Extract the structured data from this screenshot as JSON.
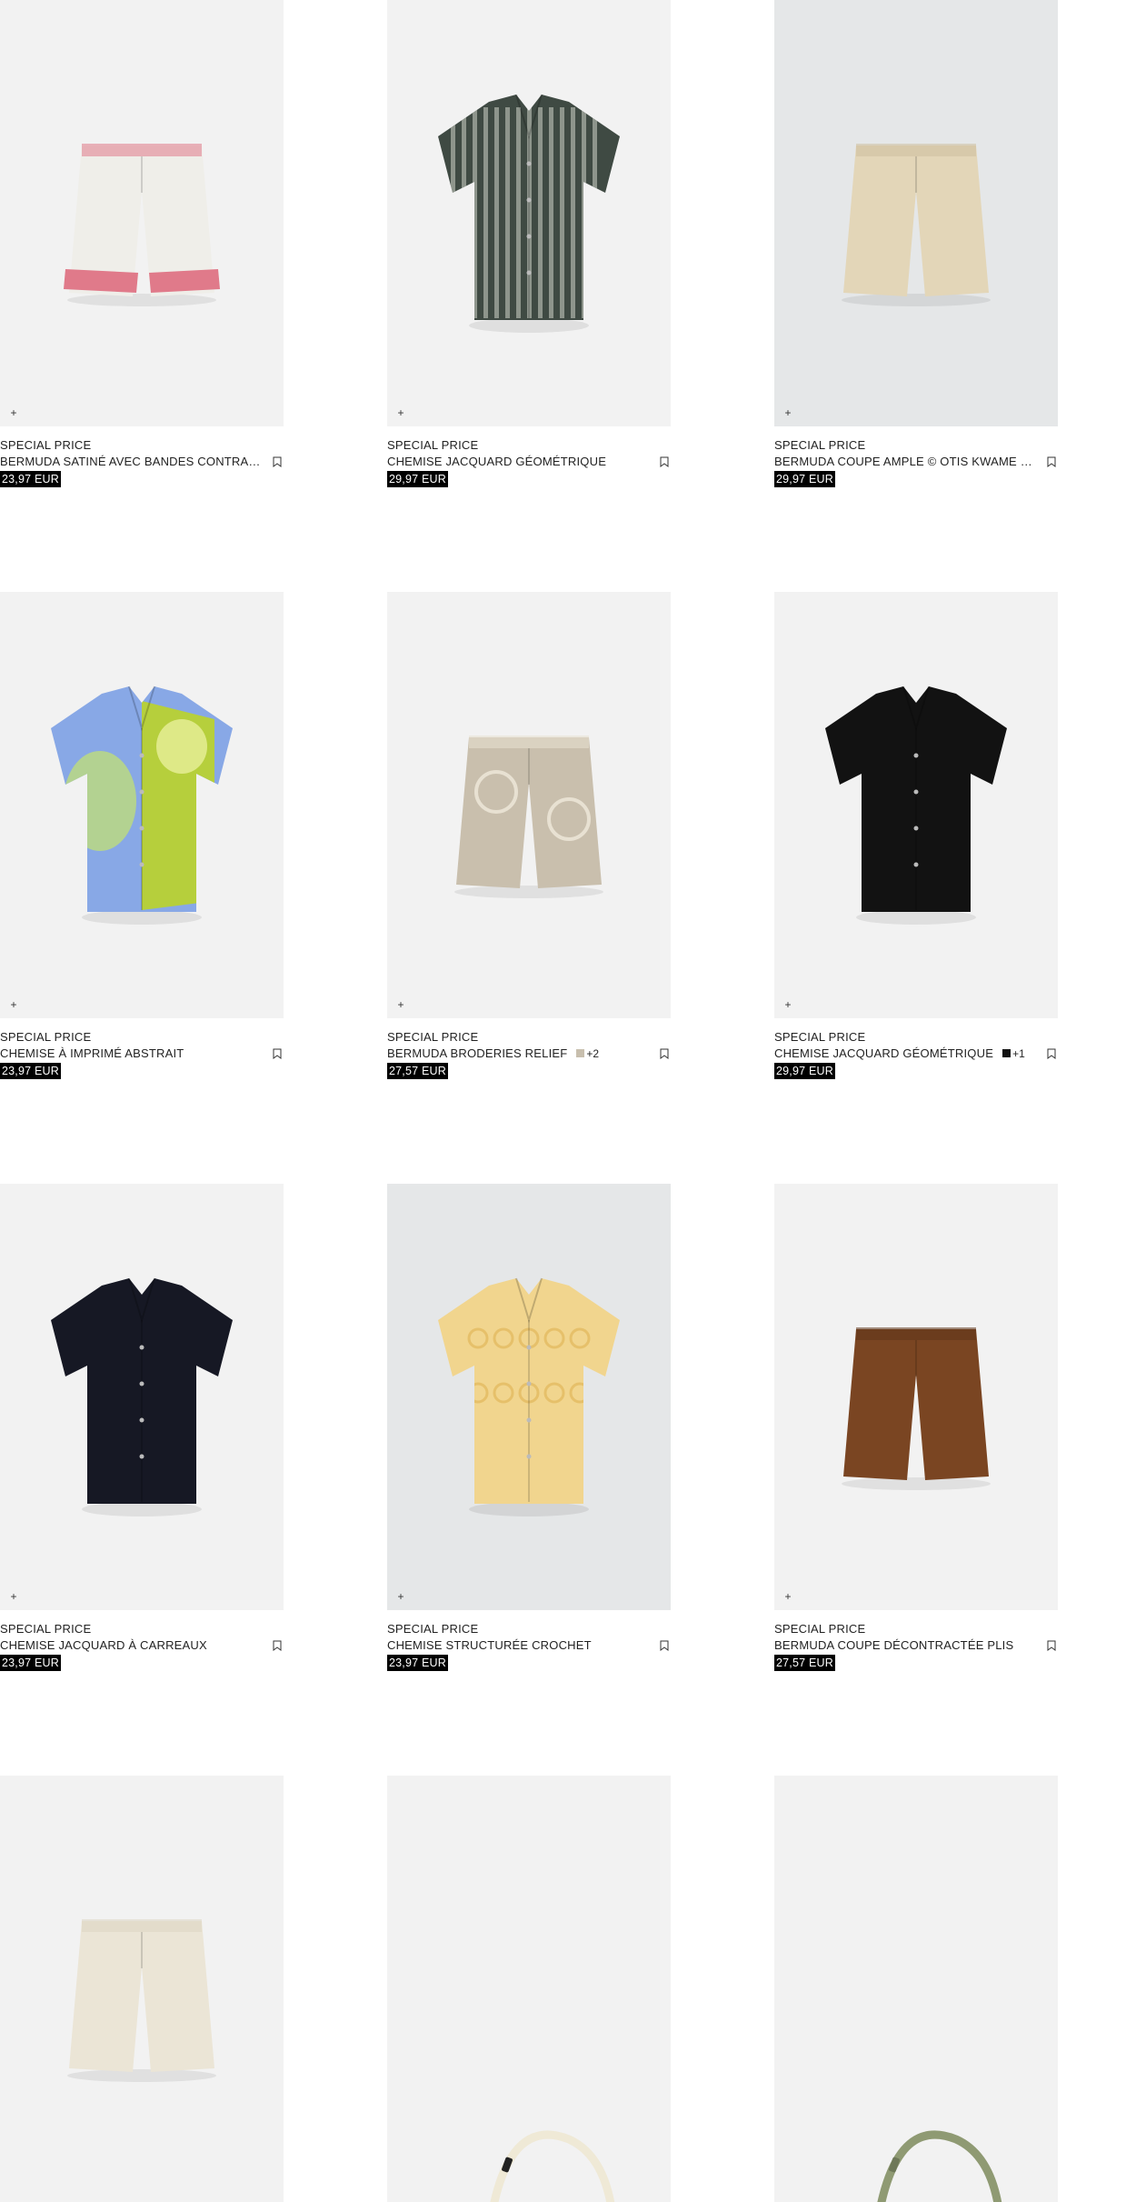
{
  "products": [
    {
      "tag": "SPECIAL PRICE",
      "name": "BERMUDA SATINÉ AVEC BANDES CONTRASTÉES",
      "price": "23,97 EUR",
      "bg": "#f2f2f2",
      "icon": "shorts-icon",
      "colors_extra": ""
    },
    {
      "tag": "SPECIAL PRICE",
      "name": "CHEMISE JACQUARD GÉOMÉTRIQUE",
      "price": "29,97 EUR",
      "bg": "#f2f2f2",
      "icon": "shirt-icon",
      "colors_extra": ""
    },
    {
      "tag": "SPECIAL PRICE",
      "name": "BERMUDA COUPE AMPLE © OTIS KWAME KYE QUAICOE",
      "price": "29,97 EUR",
      "bg": "#e5e7e8",
      "icon": "shorts-icon",
      "colors_extra": ""
    },
    {
      "tag": "SPECIAL PRICE",
      "name": "CHEMISE À IMPRIMÉ ABSTRAIT",
      "price": "23,97 EUR",
      "bg": "#f2f2f2",
      "icon": "shirt-icon",
      "colors_extra": ""
    },
    {
      "tag": "SPECIAL PRICE",
      "name": "BERMUDA BRODERIES RELIEF",
      "price": "27,57 EUR",
      "bg": "#f2f2f2",
      "icon": "shorts-icon",
      "swatch": "#c8bfae",
      "colors_extra": "+2"
    },
    {
      "tag": "SPECIAL PRICE",
      "name": "CHEMISE JACQUARD GÉOMÉTRIQUE",
      "price": "29,97 EUR",
      "bg": "#f2f2f2",
      "icon": "shirt-icon",
      "swatch": "#111111",
      "colors_extra": "+1"
    },
    {
      "tag": "SPECIAL PRICE",
      "name": "CHEMISE JACQUARD À CARREAUX",
      "price": "23,97 EUR",
      "bg": "#f2f2f2",
      "icon": "shirt-icon",
      "colors_extra": ""
    },
    {
      "tag": "SPECIAL PRICE",
      "name": "CHEMISE STRUCTURÉE CROCHET",
      "price": "23,97 EUR",
      "bg": "#e5e7e8",
      "icon": "shirt-icon",
      "colors_extra": ""
    },
    {
      "tag": "SPECIAL PRICE",
      "name": "BERMUDA COUPE DÉCONTRACTÉE PLIS",
      "price": "27,57 EUR",
      "bg": "#f2f2f2",
      "icon": "shorts-icon",
      "colors_extra": ""
    },
    {
      "bg": "#f2f2f2",
      "icon": "shorts-icon"
    },
    {
      "bg": "#f2f2f2",
      "icon": "bag-strap-icon"
    },
    {
      "bg": "#f2f2f2",
      "icon": "bag-strap-icon"
    }
  ],
  "icons": {
    "add": "plus-icon",
    "save": "bookmark-icon"
  },
  "add_symbol": "+"
}
